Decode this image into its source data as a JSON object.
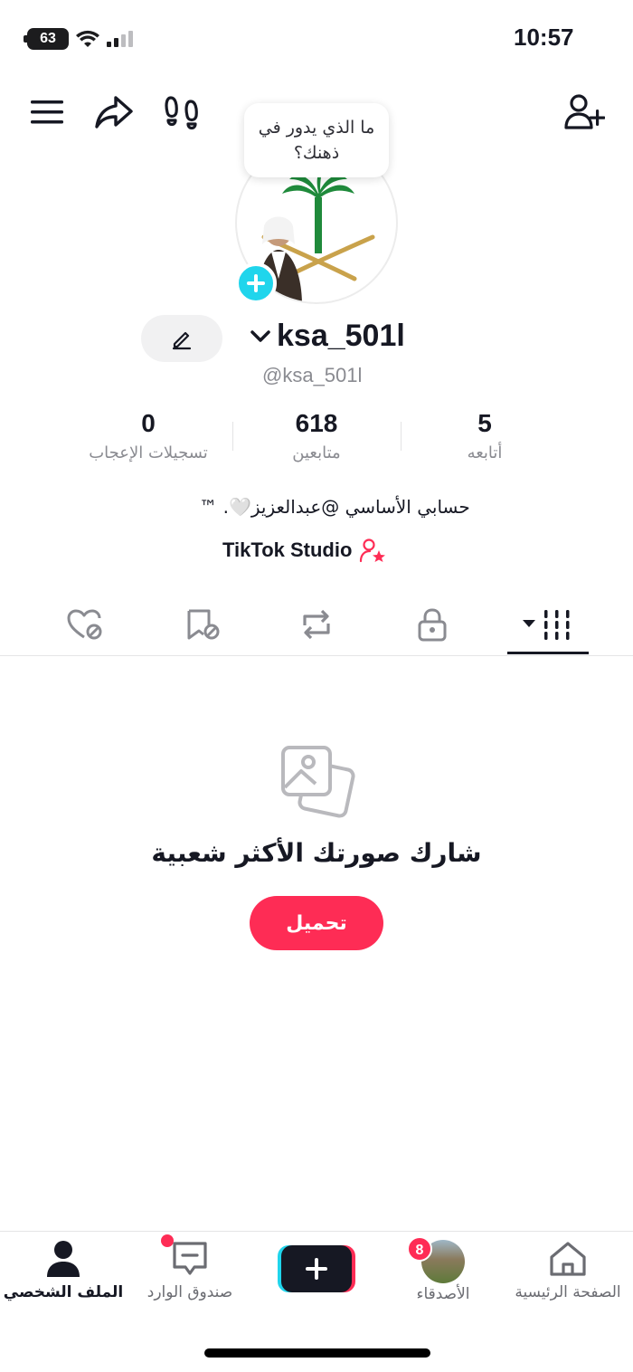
{
  "status_bar": {
    "time": "10:57",
    "battery": "63"
  },
  "header": {
    "menu_icon": "menu-icon",
    "share_icon": "share-icon",
    "footprints_icon": "footprints-icon",
    "add_user_icon": "add-user-icon"
  },
  "profile": {
    "note_bubble": "ما الذي يدور في ذهنك؟",
    "username": "ksa_501l",
    "handle": "@ksa_501l",
    "bio": "حسابي الأساسي @عبدالعزيز🤍. ™",
    "studio_link": "TikTok Studio"
  },
  "stats": [
    {
      "value": "0",
      "label": "تسجيلات الإعجاب"
    },
    {
      "value": "618",
      "label": "متابعين"
    },
    {
      "value": "5",
      "label": "أتابعه"
    }
  ],
  "tabs": [
    {
      "icon": "liked-hidden-icon"
    },
    {
      "icon": "favorites-hidden-icon"
    },
    {
      "icon": "repost-icon"
    },
    {
      "icon": "lock-icon"
    },
    {
      "icon": "grid-icon",
      "active": true
    }
  ],
  "empty_state": {
    "title": "شارك صورتك الأكثر شعبية",
    "button": "تحميل"
  },
  "bottom_nav": {
    "profile": "الملف الشخصي",
    "inbox": "صندوق الوارد",
    "friends": "الأصدقاء",
    "friends_badge": "8",
    "home": "الصفحة الرئيسية"
  },
  "colors": {
    "accent": "#fe2c55",
    "cyan": "#20d5ec",
    "text": "#161823"
  }
}
